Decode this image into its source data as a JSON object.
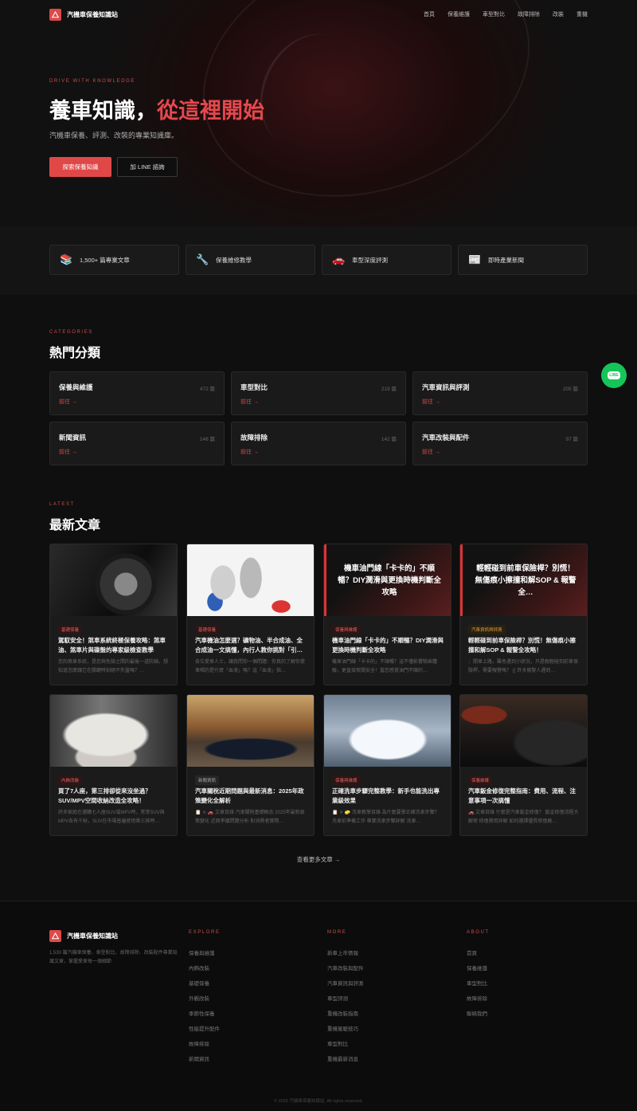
{
  "site": {
    "name": "汽機車保養知識站"
  },
  "nav": [
    "首頁",
    "保養維護",
    "車型對比",
    "故障排除",
    "改裝",
    "重機"
  ],
  "hero": {
    "eyebrow": "DRIVE WITH KNOWLEDGE",
    "title_a": "養車知識，",
    "title_b": "從這裡開始",
    "subtitle": "汽機車保養、評測、改裝的專業知識庫。",
    "cta_primary": "探索保養知識",
    "cta_secondary": "加 LINE 諮詢"
  },
  "features": [
    {
      "icon": "books-icon",
      "glyph": "📚",
      "label": "1,500+ 篇專業文章"
    },
    {
      "icon": "wrench-icon",
      "glyph": "🔧",
      "label": "保養維修教學"
    },
    {
      "icon": "car-icon",
      "glyph": "🚗",
      "label": "車型深度評測"
    },
    {
      "icon": "newspaper-icon",
      "glyph": "📰",
      "label": "即時產業新聞"
    }
  ],
  "categories": {
    "eyebrow": "CATEGORIES",
    "title": "熱門分類",
    "go_label": "前往 →",
    "items": [
      {
        "name": "保養與維護",
        "count": "472 篇"
      },
      {
        "name": "車型對比",
        "count": "219 篇"
      },
      {
        "name": "汽車資訊與評測",
        "count": "205 篇"
      },
      {
        "name": "新聞資訊",
        "count": "148 篇"
      },
      {
        "name": "故障排除",
        "count": "142 篇"
      },
      {
        "name": "汽車改裝與配件",
        "count": "97 篇"
      }
    ]
  },
  "line_fab": {
    "label": "LINE"
  },
  "latest": {
    "eyebrow": "LATEST",
    "title": "最新文章",
    "articles": [
      {
        "tag": "基礎保養",
        "title": "駕馭安全！煞車系統終極保養攻略：煞車油、煞車片與碟盤的專家級檢查教學",
        "excerpt": "您的煞車系統，是您與危險之間的最後一道防線。想知道怎麼讓它在關鍵時刻絕不失靈嗎？…",
        "image": "motorcycle-brake-photo"
      },
      {
        "tag": "基礎保養",
        "title": "汽車機油怎麼選？礦物油、半合成油、全合成油一文搞懂，內行人教你挑對「引…",
        "excerpt": "各位愛車人士，讓我問你一個問題：你真的了解你愛車喝的是什麼「血液」嗎？這「血液」指…",
        "image": "engine-oil-photo"
      },
      {
        "tag": "保養與維護",
        "title": "機車油門線「卡卡的」不順暢？DIY潤滑與更換時機判斷全攻略",
        "excerpt": "機車油門線「卡卡的」不順暢？這不僅影響騎乘體驗，更直接攸關安全！當您感覺油門不順的…",
        "image_text": "機車油門線「卡卡的」不順暢？DIY潤滑與更換時機判斷全攻略"
      },
      {
        "tag": "汽車資訊與評測",
        "title": "輕輕碰到前車保險桿？別慌！無傷痕小擦撞和解SOP & 報警全攻略！",
        "excerpt": "：開車上路，難免遇到小狀況，只是輕輕碰到前車保險桿，需要報警嗎？ {{ 許多駕駛人遇到…",
        "image_text": "輕輕碰到前車保險桿？別慌！無傷痕小擦撞和解SOP & 報警全…"
      },
      {
        "tag": "內飾改裝",
        "title": "買了7人座，第三排卻從來沒坐過？SUV/MPV空間收納改造全攻略！",
        "excerpt": "許多家庭在選購七人座SUV或MPV時，常常SUV與MPV各有千秋，SUV在市場普遍使用第三排時…",
        "image": "car-interior-seats-photo"
      },
      {
        "tag": "新聞資訊",
        "title": "汽車關稅近期問題與最新消息：2025年政策變化全解析",
        "excerpt": "📋 ✕ 🚗 文章目錄 汽車關稅基礎概念 2025年最新政策變化 近期爭議問題分析 對消費者實際…",
        "image": "sports-car-street-photo"
      },
      {
        "tag": "保養與維護",
        "title": "正確洗車步驟完整教學：新手也能洗出專業級效果",
        "excerpt": "📋 ✕ 🧽 洗車教學目錄 為什麼要學正確洗車步驟？ 洗車前準備工作 專業洗車步驟詳解 洗車…",
        "image": "car-wash-foam-photo"
      },
      {
        "tag": "保養維護",
        "title": "汽車鈑金修復完整指南：費用、流程、注意事項一次搞懂",
        "excerpt": "🚗 文章目錄 什麼是汽車鈑金修復？ 鈑金修復流程大解密 修復費用詳解 如何選擇優質修復廠…",
        "image": "sports-car-garage-photo"
      }
    ],
    "more_label": "查看更多文章 →"
  },
  "footer": {
    "desc": "1,530 篇汽機車保養、車型對比、故障排除、改裝配件專業知識文章，掌握愛車每一個細節",
    "columns": [
      {
        "heading": "EXPLORE",
        "links": [
          "保養與維護",
          "內飾改裝",
          "基礎保養",
          "外觀改裝",
          "季節性保養",
          "性能提升配件",
          "故障排除",
          "新聞資訊"
        ]
      },
      {
        "heading": "MORE",
        "links": [
          "新車上市情報",
          "汽車改裝與配件",
          "汽車資訊與評測",
          "車型評測",
          "重機改裝指南",
          "重機駕駛技巧",
          "車型對比",
          "重機最新消息"
        ]
      },
      {
        "heading": "ABOUT",
        "links": [
          "首頁",
          "保養維護",
          "車型對比",
          "故障排除",
          "聯絡我們"
        ]
      }
    ],
    "copyright": "© 2026 汽機車保養知識站. All rights reserved."
  },
  "colors": {
    "accent": "#e04848",
    "line_green": "#16c55a",
    "background": "#0f0f0f",
    "card": "#1a1a1a"
  }
}
